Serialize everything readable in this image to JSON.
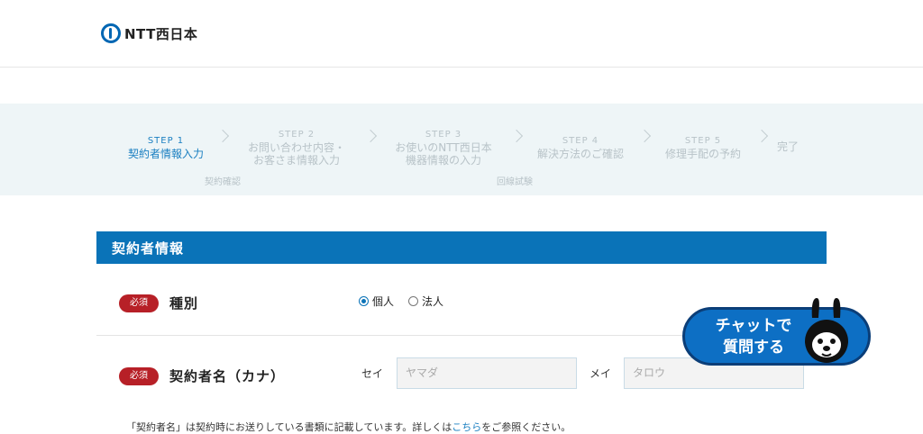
{
  "header": {
    "logo_text": "NTT西日本"
  },
  "steps": [
    {
      "no": "STEP 1",
      "label": "契約者情報入力"
    },
    {
      "no": "STEP 2",
      "label": "お問い合わせ内容・",
      "label2": "お客さま情報入力"
    },
    {
      "no": "STEP 3",
      "label": "お使いのNTT西日本",
      "label2": "機器情報の入力"
    },
    {
      "no": "STEP 4",
      "label": "解決方法のご確認"
    },
    {
      "no": "STEP 5",
      "label": "修理手配の予約"
    },
    {
      "label": "完了"
    }
  ],
  "sub_labels": [
    "契約確認",
    "回線試験"
  ],
  "section": {
    "title": "契約者情報"
  },
  "form": {
    "required_badge": "必須",
    "type_label": "種別",
    "radio_options": [
      {
        "label": "個人",
        "checked": true
      },
      {
        "label": "法人",
        "checked": false
      }
    ],
    "name_label": "契約者名（カナ）",
    "sei_caption": "セイ",
    "sei_placeholder": "ヤマダ",
    "mei_caption": "メイ",
    "mei_placeholder": "タロウ"
  },
  "note": {
    "pre": "「契約者名」は契約時にお送りしている書類に記載しています。詳しくは",
    "link": "こちら",
    "post": "をご参照ください。"
  },
  "chat": {
    "line1": "チャットで",
    "line2": "質問する"
  },
  "colors": {
    "accent": "#0a73b8",
    "required": "#b72027",
    "band": "#eef5f7"
  }
}
